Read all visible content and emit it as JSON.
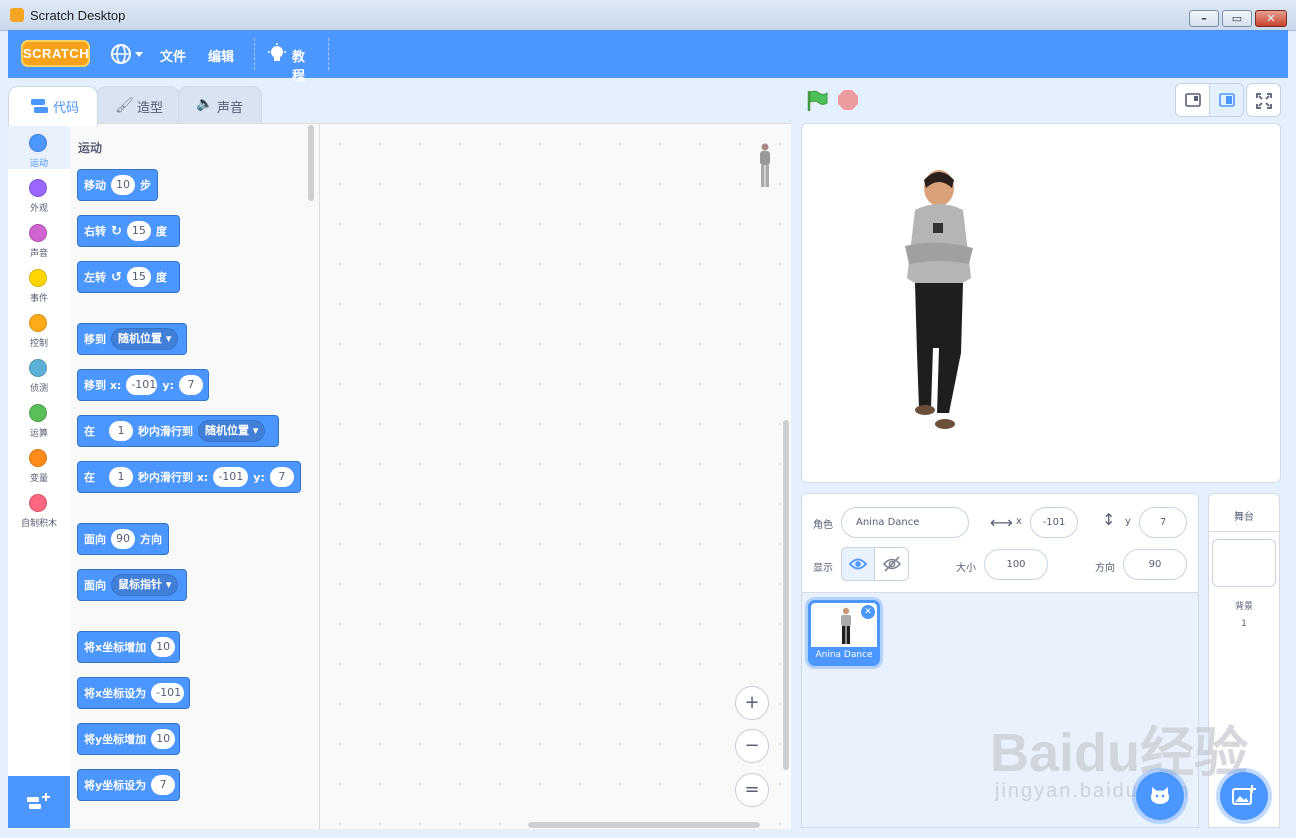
{
  "window": {
    "title": "Scratch Desktop"
  },
  "menubar": {
    "logo": "SCRATCH",
    "file": "文件",
    "edit": "编辑",
    "tutorials": "教程"
  },
  "tabs": {
    "code": "代码",
    "costumes": "造型",
    "sounds": "声音"
  },
  "categories": [
    {
      "label": "运动",
      "color": "#4c97ff"
    },
    {
      "label": "外观",
      "color": "#9966ff"
    },
    {
      "label": "声音",
      "color": "#cf63cf"
    },
    {
      "label": "事件",
      "color": "#ffd500"
    },
    {
      "label": "控制",
      "color": "#ffab19"
    },
    {
      "label": "侦测",
      "color": "#5cb1d6"
    },
    {
      "label": "运算",
      "color": "#59c059"
    },
    {
      "label": "变量",
      "color": "#ff8c1a"
    },
    {
      "label": "自制积木",
      "color": "#ff6680"
    }
  ],
  "palette": {
    "section_title": "运动",
    "move": {
      "a": "移动",
      "n": "10",
      "b": "步"
    },
    "turn_right": {
      "a": "右转",
      "n": "15",
      "b": "度"
    },
    "turn_left": {
      "a": "左转",
      "n": "15",
      "b": "度"
    },
    "goto": {
      "a": "移到",
      "dd": "随机位置"
    },
    "goto_xy": {
      "a": "移到 x:",
      "x": "-101",
      "y_lbl": "y:",
      "y": "7"
    },
    "glide": {
      "a": "在",
      "n": "1",
      "b": "秒内滑行到",
      "dd": "随机位置"
    },
    "glide_xy": {
      "a": "在",
      "n": "1",
      "b": "秒内滑行到 x:",
      "x": "-101",
      "y_lbl": "y:",
      "y": "7"
    },
    "point_dir": {
      "a": "面向",
      "n": "90",
      "b": "方向"
    },
    "point_towards": {
      "a": "面向",
      "dd": "鼠标指针"
    },
    "change_x": {
      "a": "将x坐标增加",
      "n": "10"
    },
    "set_x": {
      "a": "将x坐标设为",
      "n": "-101"
    },
    "change_y": {
      "a": "将y坐标增加",
      "n": "10"
    },
    "set_y": {
      "a": "将y坐标设为",
      "n": "7"
    }
  },
  "zoom": {
    "in": "+",
    "out": "−",
    "reset": "="
  },
  "sprite_info": {
    "sprite_label": "角色",
    "sprite_name": "Anina Dance",
    "x_label": "x",
    "x": "-101",
    "y_label": "y",
    "y": "7",
    "show_label": "显示",
    "size_label": "大小",
    "size": "100",
    "direction_label": "方向",
    "direction": "90"
  },
  "sprite_list": [
    {
      "name": "Anina Dance",
      "selected": true
    }
  ],
  "stage_panel": {
    "title": "舞台",
    "backdrops_label": "背景",
    "backdrops_count": "1"
  },
  "watermark": {
    "text": "Baidu经验",
    "sub": "jingyan.baidu.com"
  },
  "colors": {
    "accent": "#4c97ff",
    "menubar": "#4c97ff",
    "motion": "#4c97ff",
    "flag": "#4cbf56",
    "stop": "#ec9c9c"
  }
}
